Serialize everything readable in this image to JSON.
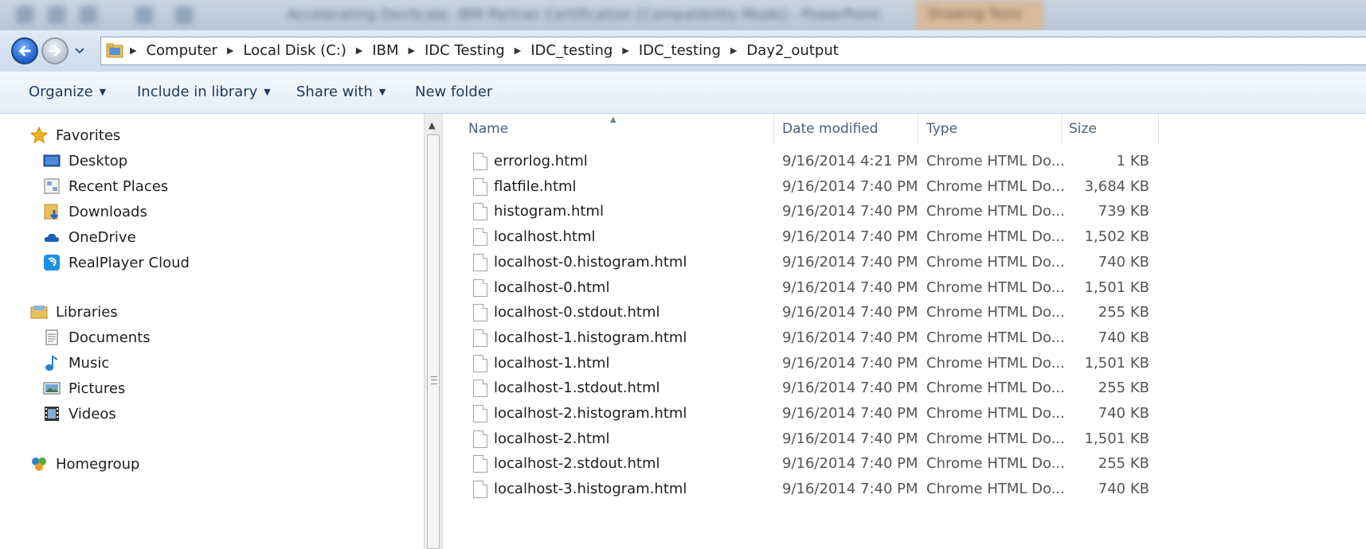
{
  "window": {
    "title": "Accelerating DevScale: IBM Partner Certification [Compatibility Mode] - PowerPoint",
    "tab": "Drawing Tools"
  },
  "address": {
    "breadcrumbs": [
      "Computer",
      "Local Disk (C:)",
      "IBM",
      "IDC Testing",
      "IDC_testing",
      "IDC_testing",
      "Day2_output"
    ]
  },
  "toolbar": {
    "organize": "Organize",
    "include_in_library": "Include in library",
    "share_with": "Share with",
    "new_folder": "New folder"
  },
  "nav": {
    "favorites": {
      "label": "Favorites",
      "items": [
        "Desktop",
        "Recent Places",
        "Downloads",
        "OneDrive",
        "RealPlayer Cloud"
      ]
    },
    "libraries": {
      "label": "Libraries",
      "items": [
        "Documents",
        "Music",
        "Pictures",
        "Videos"
      ]
    },
    "homegroup": "Homegroup"
  },
  "columns": {
    "name": "Name",
    "date_modified": "Date modified",
    "type": "Type",
    "size": "Size"
  },
  "files": [
    {
      "name": "errorlog.html",
      "date": "9/16/2014 4:21 PM",
      "type": "Chrome HTML Do...",
      "size": "1 KB"
    },
    {
      "name": "flatfile.html",
      "date": "9/16/2014 7:40 PM",
      "type": "Chrome HTML Do...",
      "size": "3,684 KB"
    },
    {
      "name": "histogram.html",
      "date": "9/16/2014 7:40 PM",
      "type": "Chrome HTML Do...",
      "size": "739 KB"
    },
    {
      "name": "localhost.html",
      "date": "9/16/2014 7:40 PM",
      "type": "Chrome HTML Do...",
      "size": "1,502 KB"
    },
    {
      "name": "localhost-0.histogram.html",
      "date": "9/16/2014 7:40 PM",
      "type": "Chrome HTML Do...",
      "size": "740 KB"
    },
    {
      "name": "localhost-0.html",
      "date": "9/16/2014 7:40 PM",
      "type": "Chrome HTML Do...",
      "size": "1,501 KB"
    },
    {
      "name": "localhost-0.stdout.html",
      "date": "9/16/2014 7:40 PM",
      "type": "Chrome HTML Do...",
      "size": "255 KB"
    },
    {
      "name": "localhost-1.histogram.html",
      "date": "9/16/2014 7:40 PM",
      "type": "Chrome HTML Do...",
      "size": "740 KB"
    },
    {
      "name": "localhost-1.html",
      "date": "9/16/2014 7:40 PM",
      "type": "Chrome HTML Do...",
      "size": "1,501 KB"
    },
    {
      "name": "localhost-1.stdout.html",
      "date": "9/16/2014 7:40 PM",
      "type": "Chrome HTML Do...",
      "size": "255 KB"
    },
    {
      "name": "localhost-2.histogram.html",
      "date": "9/16/2014 7:40 PM",
      "type": "Chrome HTML Do...",
      "size": "740 KB"
    },
    {
      "name": "localhost-2.html",
      "date": "9/16/2014 7:40 PM",
      "type": "Chrome HTML Do...",
      "size": "1,501 KB"
    },
    {
      "name": "localhost-2.stdout.html",
      "date": "9/16/2014 7:40 PM",
      "type": "Chrome HTML Do...",
      "size": "255 KB"
    },
    {
      "name": "localhost-3.histogram.html",
      "date": "9/16/2014 7:40 PM",
      "type": "Chrome HTML Do...",
      "size": "740 KB"
    }
  ],
  "icons": {
    "back": "back-arrow-icon",
    "forward": "forward-arrow-icon",
    "folder": "folder-icon",
    "file": "html-file-icon"
  },
  "colors": {
    "toolbar_text": "#1e395b",
    "accent": "#1c5fc9"
  }
}
